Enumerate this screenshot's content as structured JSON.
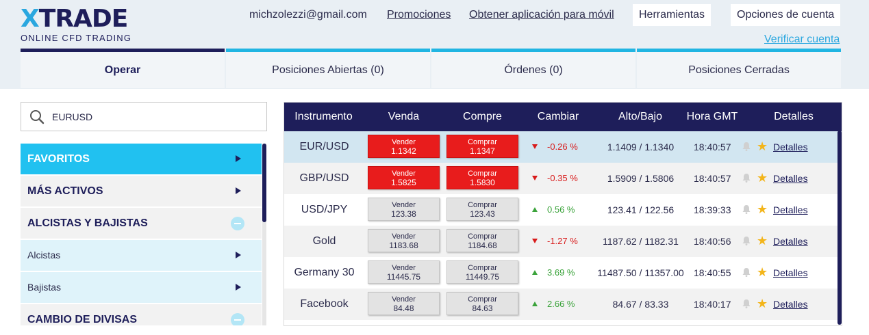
{
  "logo": {
    "brand_x": "X",
    "brand_rest": "TRADE",
    "tagline": "ONLINE CFD TRADING"
  },
  "header": {
    "email": "michzolezzi@gmail.com",
    "promotions": "Promociones",
    "mobile_app": "Obtener aplicación para móvil",
    "tools": "Herramientas",
    "account_options": "Opciones de cuenta",
    "verify_account": "Verificar cuenta"
  },
  "tabs": [
    {
      "label": "Operar"
    },
    {
      "label": "Posiciones Abiertas (0)"
    },
    {
      "label": "Órdenes (0)"
    },
    {
      "label": "Posiciones Cerradas"
    }
  ],
  "search": {
    "value": "EURUSD"
  },
  "categories": [
    {
      "label": "FAVORITOS"
    },
    {
      "label": "MÁS ACTIVOS"
    },
    {
      "label": "ALCISTAS Y BAJISTAS"
    },
    {
      "label": "Alcistas"
    },
    {
      "label": "Bajistas"
    },
    {
      "label": "CAMBIO DE DIVISAS"
    }
  ],
  "table": {
    "headers": {
      "instrument": "Instrumento",
      "sell": "Venda",
      "buy": "Compre",
      "change": "Cambiar",
      "high_low": "Alto/Bajo",
      "time": "Hora GMT",
      "details": "Detalles"
    },
    "rows": [
      {
        "instrument": "EUR/USD",
        "sell_label": "Vender",
        "sell": "1.1342",
        "buy_label": "Comprar",
        "buy": "1.1347",
        "change": "-0.26 %",
        "direction": "down",
        "high_low": "1.1409 / 1.1340",
        "time": "18:40:57",
        "details": "Detalles"
      },
      {
        "instrument": "GBP/USD",
        "sell_label": "Vender",
        "sell": "1.5825",
        "buy_label": "Comprar",
        "buy": "1.5830",
        "change": "-0.35 %",
        "direction": "down",
        "high_low": "1.5909 / 1.5806",
        "time": "18:40:57",
        "details": "Detalles"
      },
      {
        "instrument": "USD/JPY",
        "sell_label": "Vender",
        "sell": "123.38",
        "buy_label": "Comprar",
        "buy": "123.43",
        "change": "0.56 %",
        "direction": "up",
        "high_low": "123.41 / 122.56",
        "time": "18:39:33",
        "details": "Detalles"
      },
      {
        "instrument": "Gold",
        "sell_label": "Vender",
        "sell": "1183.68",
        "buy_label": "Comprar",
        "buy": "1184.68",
        "change": "-1.27 %",
        "direction": "down",
        "high_low": "1187.62 / 1182.31",
        "time": "18:40:56",
        "details": "Detalles"
      },
      {
        "instrument": "Germany 30",
        "sell_label": "Vender",
        "sell": "11445.75",
        "buy_label": "Comprar",
        "buy": "11449.75",
        "change": "3.69 %",
        "direction": "up",
        "high_low": "11487.50 / 11357.00",
        "time": "18:40:55",
        "details": "Detalles"
      },
      {
        "instrument": "Facebook",
        "sell_label": "Vender",
        "sell": "84.48",
        "buy_label": "Comprar",
        "buy": "84.63",
        "change": "2.66 %",
        "direction": "up",
        "high_low": "84.67 / 83.33",
        "time": "18:40:17",
        "details": "Detalles"
      }
    ]
  },
  "colors": {
    "navy": "#1e1e5a",
    "accent": "#21b5e2",
    "sell_red": "#e81c1c",
    "up": "#3ba33b",
    "down": "#d81b1b",
    "star": "#f3b51a"
  },
  "icons": {
    "search": "search-icon",
    "bell": "bell-icon",
    "star": "star-icon",
    "arrow": "arrow-right-icon",
    "collapse": "minus-circle-icon"
  }
}
